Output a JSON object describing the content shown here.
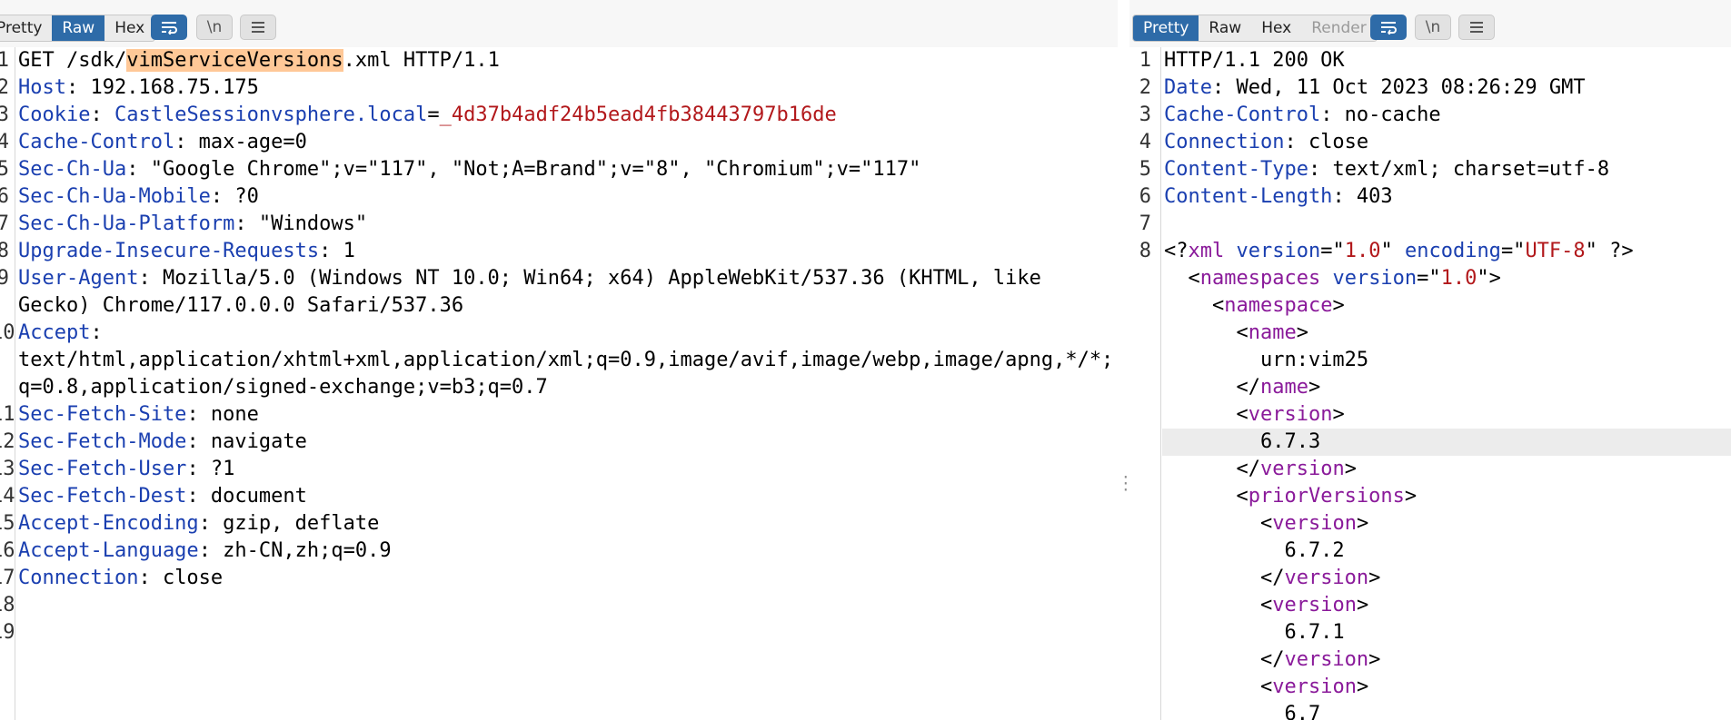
{
  "request": {
    "tabs": [
      "Pretty",
      "Raw",
      "Hex"
    ],
    "active_tab": "Raw",
    "icons": [
      "wrap-icon",
      "newline-icon",
      "menu-icon"
    ],
    "newline_label": "\\n",
    "lines": [
      {
        "n": "1",
        "parts": [
          {
            "t": "GET /sdk/",
            "c": "v"
          },
          {
            "t": "vimServiceVersions",
            "c": "hl"
          },
          {
            "t": ".xml HTTP/1.1",
            "c": "v"
          }
        ]
      },
      {
        "n": "2",
        "parts": [
          {
            "t": "Host",
            "c": "k"
          },
          {
            "t": ": 192.168.75.175",
            "c": "v"
          }
        ]
      },
      {
        "n": "3",
        "parts": [
          {
            "t": "Cookie",
            "c": "k"
          },
          {
            "t": ": ",
            "c": "v"
          },
          {
            "t": "CastleSessionvsphere.local",
            "c": "k"
          },
          {
            "t": "=",
            "c": "v"
          },
          {
            "t": "_4d37b4adf24b5ead4fb38443797b16de",
            "c": "cv"
          }
        ]
      },
      {
        "n": "4",
        "parts": [
          {
            "t": "Cache-Control",
            "c": "k"
          },
          {
            "t": ": max-age=0",
            "c": "v"
          }
        ]
      },
      {
        "n": "5",
        "parts": [
          {
            "t": "Sec-Ch-Ua",
            "c": "k"
          },
          {
            "t": ": \"Google Chrome\";v=\"117\", \"Not;A=Brand\";v=\"8\", \"Chromium\";v=\"117\"",
            "c": "v"
          }
        ]
      },
      {
        "n": "6",
        "parts": [
          {
            "t": "Sec-Ch-Ua-Mobile",
            "c": "k"
          },
          {
            "t": ": ?0",
            "c": "v"
          }
        ]
      },
      {
        "n": "7",
        "parts": [
          {
            "t": "Sec-Ch-Ua-Platform",
            "c": "k"
          },
          {
            "t": ": \"Windows\"",
            "c": "v"
          }
        ]
      },
      {
        "n": "8",
        "parts": [
          {
            "t": "Upgrade-Insecure-Requests",
            "c": "k"
          },
          {
            "t": ": 1",
            "c": "v"
          }
        ]
      },
      {
        "n": "9",
        "parts": [
          {
            "t": "User-Agent",
            "c": "k"
          },
          {
            "t": ": Mozilla/5.0 (Windows NT 10.0; Win64; x64) AppleWebKit/537.36 (KHTML, like",
            "c": "v"
          }
        ]
      },
      {
        "n": "",
        "parts": [
          {
            "t": "Gecko) Chrome/117.0.0.0 Safari/537.36",
            "c": "v"
          }
        ]
      },
      {
        "n": "10",
        "parts": [
          {
            "t": "Accept",
            "c": "k"
          },
          {
            "t": ":",
            "c": "v"
          }
        ]
      },
      {
        "n": "",
        "parts": [
          {
            "t": "text/html,application/xhtml+xml,application/xml;q=0.9,image/avif,image/webp,image/apng,*/*;",
            "c": "v"
          }
        ]
      },
      {
        "n": "",
        "parts": [
          {
            "t": "q=0.8,application/signed-exchange;v=b3;q=0.7",
            "c": "v"
          }
        ]
      },
      {
        "n": "11",
        "parts": [
          {
            "t": "Sec-Fetch-Site",
            "c": "k"
          },
          {
            "t": ": none",
            "c": "v"
          }
        ]
      },
      {
        "n": "12",
        "parts": [
          {
            "t": "Sec-Fetch-Mode",
            "c": "k"
          },
          {
            "t": ": navigate",
            "c": "v"
          }
        ]
      },
      {
        "n": "13",
        "parts": [
          {
            "t": "Sec-Fetch-User",
            "c": "k"
          },
          {
            "t": ": ?1",
            "c": "v"
          }
        ]
      },
      {
        "n": "14",
        "parts": [
          {
            "t": "Sec-Fetch-Dest",
            "c": "k"
          },
          {
            "t": ": document",
            "c": "v"
          }
        ]
      },
      {
        "n": "15",
        "parts": [
          {
            "t": "Accept-Encoding",
            "c": "k"
          },
          {
            "t": ": gzip, deflate",
            "c": "v"
          }
        ]
      },
      {
        "n": "16",
        "parts": [
          {
            "t": "Accept-Language",
            "c": "k"
          },
          {
            "t": ": zh-CN,zh;q=0.9",
            "c": "v"
          }
        ]
      },
      {
        "n": "17",
        "parts": [
          {
            "t": "Connection",
            "c": "k"
          },
          {
            "t": ": close",
            "c": "v"
          }
        ]
      },
      {
        "n": "18",
        "parts": []
      },
      {
        "n": "19",
        "parts": []
      }
    ]
  },
  "response": {
    "tabs": [
      "Pretty",
      "Raw",
      "Hex",
      "Render"
    ],
    "active_tab": "Pretty",
    "disabled_tab": "Render",
    "icons": [
      "wrap-icon",
      "newline-icon",
      "menu-icon"
    ],
    "newline_label": "\\n",
    "current_line_index": 14,
    "lines": [
      {
        "n": "1",
        "parts": [
          {
            "t": "HTTP/1.1 200 OK",
            "c": "v"
          }
        ]
      },
      {
        "n": "2",
        "parts": [
          {
            "t": "Date",
            "c": "k"
          },
          {
            "t": ": Wed, 11 Oct 2023 08:26:29 GMT",
            "c": "v"
          }
        ]
      },
      {
        "n": "3",
        "parts": [
          {
            "t": "Cache-Control",
            "c": "k"
          },
          {
            "t": ": no-cache",
            "c": "v"
          }
        ]
      },
      {
        "n": "4",
        "parts": [
          {
            "t": "Connection",
            "c": "k"
          },
          {
            "t": ": close",
            "c": "v"
          }
        ]
      },
      {
        "n": "5",
        "parts": [
          {
            "t": "Content-Type",
            "c": "k"
          },
          {
            "t": ": text/xml; charset=utf-8",
            "c": "v"
          }
        ]
      },
      {
        "n": "6",
        "parts": [
          {
            "t": "Content-Length",
            "c": "k"
          },
          {
            "t": ": 403",
            "c": "v"
          }
        ]
      },
      {
        "n": "7",
        "parts": []
      },
      {
        "n": "8",
        "parts": [
          {
            "t": "<?",
            "c": "v"
          },
          {
            "t": "xml",
            "c": "tag"
          },
          {
            "t": " ",
            "c": "v"
          },
          {
            "t": "version",
            "c": "xattr"
          },
          {
            "t": "=\"",
            "c": "v"
          },
          {
            "t": "1.0",
            "c": "xval"
          },
          {
            "t": "\" ",
            "c": "v"
          },
          {
            "t": "encoding",
            "c": "xattr"
          },
          {
            "t": "=\"",
            "c": "v"
          },
          {
            "t": "UTF-8",
            "c": "xval"
          },
          {
            "t": "\" ?>",
            "c": "v"
          }
        ]
      },
      {
        "n": "",
        "parts": [
          {
            "t": "  <",
            "c": "v"
          },
          {
            "t": "namespaces",
            "c": "tag"
          },
          {
            "t": " ",
            "c": "v"
          },
          {
            "t": "version",
            "c": "xattr"
          },
          {
            "t": "=\"",
            "c": "v"
          },
          {
            "t": "1.0",
            "c": "xval"
          },
          {
            "t": "\">",
            "c": "v"
          }
        ]
      },
      {
        "n": "",
        "parts": [
          {
            "t": "    <",
            "c": "v"
          },
          {
            "t": "namespace",
            "c": "tag"
          },
          {
            "t": ">",
            "c": "v"
          }
        ]
      },
      {
        "n": "",
        "parts": [
          {
            "t": "      <",
            "c": "v"
          },
          {
            "t": "name",
            "c": "tag"
          },
          {
            "t": ">",
            "c": "v"
          }
        ]
      },
      {
        "n": "",
        "parts": [
          {
            "t": "        urn:vim25",
            "c": "v"
          }
        ]
      },
      {
        "n": "",
        "parts": [
          {
            "t": "      </",
            "c": "v"
          },
          {
            "t": "name",
            "c": "tag"
          },
          {
            "t": ">",
            "c": "v"
          }
        ]
      },
      {
        "n": "",
        "parts": [
          {
            "t": "      <",
            "c": "v"
          },
          {
            "t": "version",
            "c": "tag"
          },
          {
            "t": ">",
            "c": "v"
          }
        ]
      },
      {
        "n": "",
        "parts": [
          {
            "t": "        6.7.3",
            "c": "v"
          }
        ]
      },
      {
        "n": "",
        "parts": [
          {
            "t": "      </",
            "c": "v"
          },
          {
            "t": "version",
            "c": "tag"
          },
          {
            "t": ">",
            "c": "v"
          }
        ]
      },
      {
        "n": "",
        "parts": [
          {
            "t": "      <",
            "c": "v"
          },
          {
            "t": "priorVersions",
            "c": "tag"
          },
          {
            "t": ">",
            "c": "v"
          }
        ]
      },
      {
        "n": "",
        "parts": [
          {
            "t": "        <",
            "c": "v"
          },
          {
            "t": "version",
            "c": "tag"
          },
          {
            "t": ">",
            "c": "v"
          }
        ]
      },
      {
        "n": "",
        "parts": [
          {
            "t": "          6.7.2",
            "c": "v"
          }
        ]
      },
      {
        "n": "",
        "parts": [
          {
            "t": "        </",
            "c": "v"
          },
          {
            "t": "version",
            "c": "tag"
          },
          {
            "t": ">",
            "c": "v"
          }
        ]
      },
      {
        "n": "",
        "parts": [
          {
            "t": "        <",
            "c": "v"
          },
          {
            "t": "version",
            "c": "tag"
          },
          {
            "t": ">",
            "c": "v"
          }
        ]
      },
      {
        "n": "",
        "parts": [
          {
            "t": "          6.7.1",
            "c": "v"
          }
        ]
      },
      {
        "n": "",
        "parts": [
          {
            "t": "        </",
            "c": "v"
          },
          {
            "t": "version",
            "c": "tag"
          },
          {
            "t": ">",
            "c": "v"
          }
        ]
      },
      {
        "n": "",
        "parts": [
          {
            "t": "        <",
            "c": "v"
          },
          {
            "t": "version",
            "c": "tag"
          },
          {
            "t": ">",
            "c": "v"
          }
        ]
      },
      {
        "n": "",
        "parts": [
          {
            "t": "          6.7",
            "c": "v"
          }
        ]
      }
    ]
  }
}
